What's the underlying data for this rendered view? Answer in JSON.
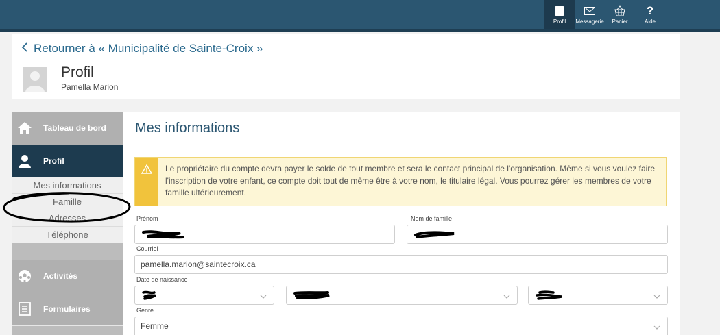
{
  "topnav": {
    "items": [
      {
        "label": "Profil",
        "icon": "profile-icon"
      },
      {
        "label": "Messagerie",
        "icon": "mail-icon"
      },
      {
        "label": "Panier",
        "icon": "basket-icon"
      },
      {
        "label": "Aide",
        "icon": "help-icon"
      }
    ]
  },
  "back": {
    "label": "Retourner à « Municipalité de Sainte-Croix »"
  },
  "profile": {
    "title": "Profil",
    "name": "Pamella Marion"
  },
  "sidebar": {
    "items": [
      {
        "label": "Tableau de bord",
        "icon": "home-icon"
      },
      {
        "label": "Profil",
        "icon": "user-icon"
      },
      {
        "label": "Activités",
        "icon": "soccer-ball-icon"
      },
      {
        "label": "Formulaires",
        "icon": "form-icon"
      }
    ],
    "sub_items": [
      "Mes informations",
      "Famille",
      "Adresses",
      "Téléphone"
    ]
  },
  "main": {
    "title": "Mes informations",
    "alert": "Le propriétaire du compte devra payer le solde de tout membre et sera le contact principal de l'organisation. Même si vous voulez faire l'inscription de votre enfant, ce compte doit tout de même être à votre nom, le titulaire légal. Vous pourrez gérer les membres de votre famille ultérieurement.",
    "form": {
      "first_name_label": "Prénom",
      "last_name_label": "Nom de famille",
      "email_label": "Courriel",
      "email_value": "pamella.marion@saintecroix.ca",
      "birth_label": "Date de naissance",
      "gender_label": "Genre",
      "gender_value": "Femme"
    }
  },
  "colors": {
    "topbar": "#2b5671",
    "accent": "#2b6a8e",
    "sidebar_active": "#1d3b4f",
    "alert_bar": "#f1c33c"
  }
}
